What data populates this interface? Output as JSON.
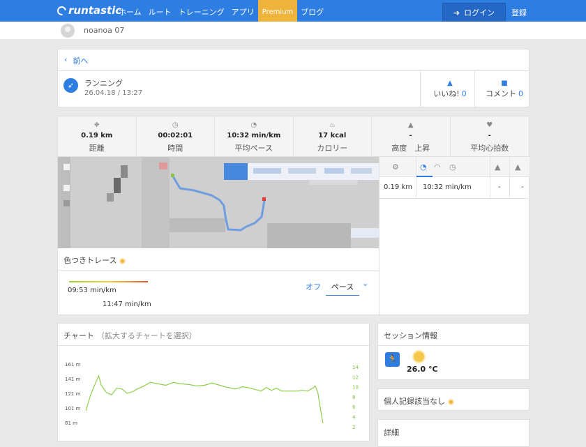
{
  "nav": {
    "brand": "runtastic",
    "items": [
      "ホーム",
      "ルート",
      "トレーニング",
      "アプリ",
      "Premium",
      "ブログ"
    ],
    "login": "ログイン",
    "register": "登録"
  },
  "user": {
    "name": "noanoa 07"
  },
  "back": {
    "label": "前へ"
  },
  "activity": {
    "type": "ランニング",
    "date": "26.04.18 / 13:27",
    "like_label": "いいね!",
    "like_count": "0",
    "comment_label": "コメント",
    "comment_count": "0"
  },
  "stats": [
    {
      "icon": "road-icon",
      "value": "0.19 km",
      "label": "距離"
    },
    {
      "icon": "clock-icon",
      "value": "00:02:01",
      "label": "時間"
    },
    {
      "icon": "pace-icon",
      "value": "10:32 min/km",
      "label": "平均ペース"
    },
    {
      "icon": "flame-icon",
      "value": "17 kcal",
      "label": "カロリー"
    },
    {
      "icon": "elevation-icon",
      "value": "-",
      "label": "高度　上昇"
    },
    {
      "icon": "heart-icon",
      "value": "-",
      "label": "平均心拍数"
    }
  ],
  "trace": {
    "title": "色つきトレース",
    "fast": "09:53 min/km",
    "slow": "11:47 min/km",
    "off": "オフ",
    "mode": "ペース"
  },
  "split_table": {
    "row": {
      "distance": "0.19 km",
      "pace": "10:32 min/km",
      "up": "-",
      "down": "-"
    }
  },
  "chart": {
    "title": "チャート",
    "subtitle": "（拡大するチャートを選択）"
  },
  "chart_data": {
    "type": "line",
    "title": "",
    "y_left_ticks": [
      "161 m",
      "141 m",
      "121 m",
      "101 m",
      "81 m"
    ],
    "y_right_ticks": [
      "14",
      "12",
      "10",
      "8",
      "6",
      "4",
      "2"
    ],
    "ylim_left": [
      81,
      161
    ],
    "series": [
      {
        "name": "",
        "color": "#8fce4a",
        "points": [
          [
            0,
            97
          ],
          [
            2,
            120
          ],
          [
            4,
            137
          ],
          [
            5,
            145
          ],
          [
            6,
            132
          ],
          [
            8,
            122
          ],
          [
            10,
            119
          ],
          [
            12,
            128
          ],
          [
            14,
            127
          ],
          [
            16,
            121
          ],
          [
            18,
            123
          ],
          [
            20,
            127
          ],
          [
            22,
            130
          ],
          [
            25,
            136
          ],
          [
            28,
            134
          ],
          [
            31,
            132
          ],
          [
            34,
            136
          ],
          [
            37,
            134
          ],
          [
            40,
            133
          ],
          [
            43,
            131
          ],
          [
            46,
            132
          ],
          [
            49,
            135
          ],
          [
            52,
            132
          ],
          [
            55,
            129
          ],
          [
            58,
            127
          ],
          [
            61,
            130
          ],
          [
            64,
            128
          ],
          [
            66,
            126
          ],
          [
            68,
            124
          ],
          [
            70,
            129
          ],
          [
            72,
            125
          ],
          [
            74,
            128
          ],
          [
            76,
            124
          ],
          [
            78,
            124
          ],
          [
            80,
            124
          ],
          [
            82,
            124
          ],
          [
            84,
            125
          ],
          [
            86,
            124
          ],
          [
            88,
            128
          ],
          [
            89,
            131
          ],
          [
            90,
            122
          ],
          [
            91,
            100
          ],
          [
            92,
            80
          ]
        ]
      }
    ]
  },
  "session": {
    "title": "セッション情報",
    "temperature": "26.0 °C"
  },
  "records": {
    "title": "個人記録該当なし"
  },
  "details": {
    "title": "詳細"
  }
}
